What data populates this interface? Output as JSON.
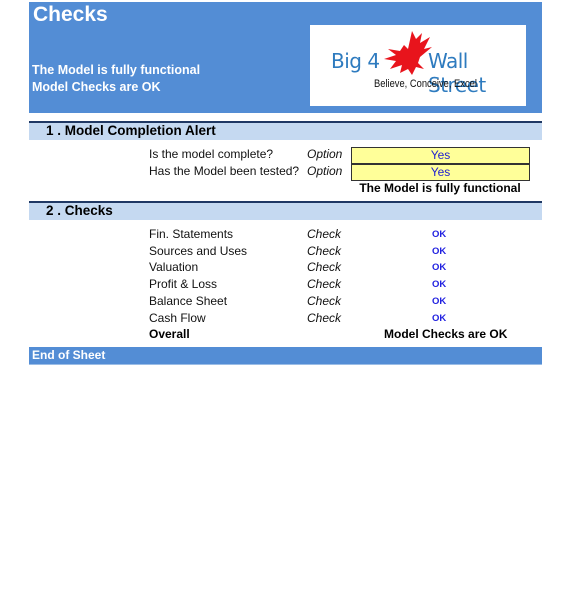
{
  "header": {
    "title": "Checks",
    "status_lines": [
      "The Model is fully functional",
      "Model Checks are OK"
    ],
    "logo": {
      "left_text": "Big 4",
      "right_text": "Wall Street",
      "tagline": "Believe, Conceive, Excel",
      "icon": "eagle-icon"
    }
  },
  "sections": [
    {
      "title": "1 . Model Completion Alert",
      "questions": [
        {
          "label": "Is the model complete?",
          "type": "Option",
          "value": "Yes"
        },
        {
          "label": "Has the Model been tested?",
          "type": "Option",
          "value": "Yes"
        }
      ],
      "result": "The Model is fully functional"
    },
    {
      "title": "2 . Checks",
      "checks": [
        {
          "label": "Fin. Statements",
          "type": "Check",
          "status": "OK"
        },
        {
          "label": "Sources and Uses",
          "type": "Check",
          "status": "OK"
        },
        {
          "label": "Valuation",
          "type": "Check",
          "status": "OK"
        },
        {
          "label": "Profit & Loss",
          "type": "Check",
          "status": "OK"
        },
        {
          "label": "Balance Sheet",
          "type": "Check",
          "status": "OK"
        },
        {
          "label": "Cash Flow",
          "type": "Check",
          "status": "OK"
        }
      ],
      "overall_label": "Overall",
      "overall_value": "Model Checks are OK"
    }
  ],
  "footer": {
    "label": "End of Sheet"
  },
  "colors": {
    "header_bg": "#538dd5",
    "section_bg": "#c5d9f1",
    "section_border": "#1f3864",
    "input_bg": "#ffff99",
    "input_text": "#1f1fd0",
    "logo_text": "#2e7bbf",
    "eagle": "#e8141c"
  }
}
